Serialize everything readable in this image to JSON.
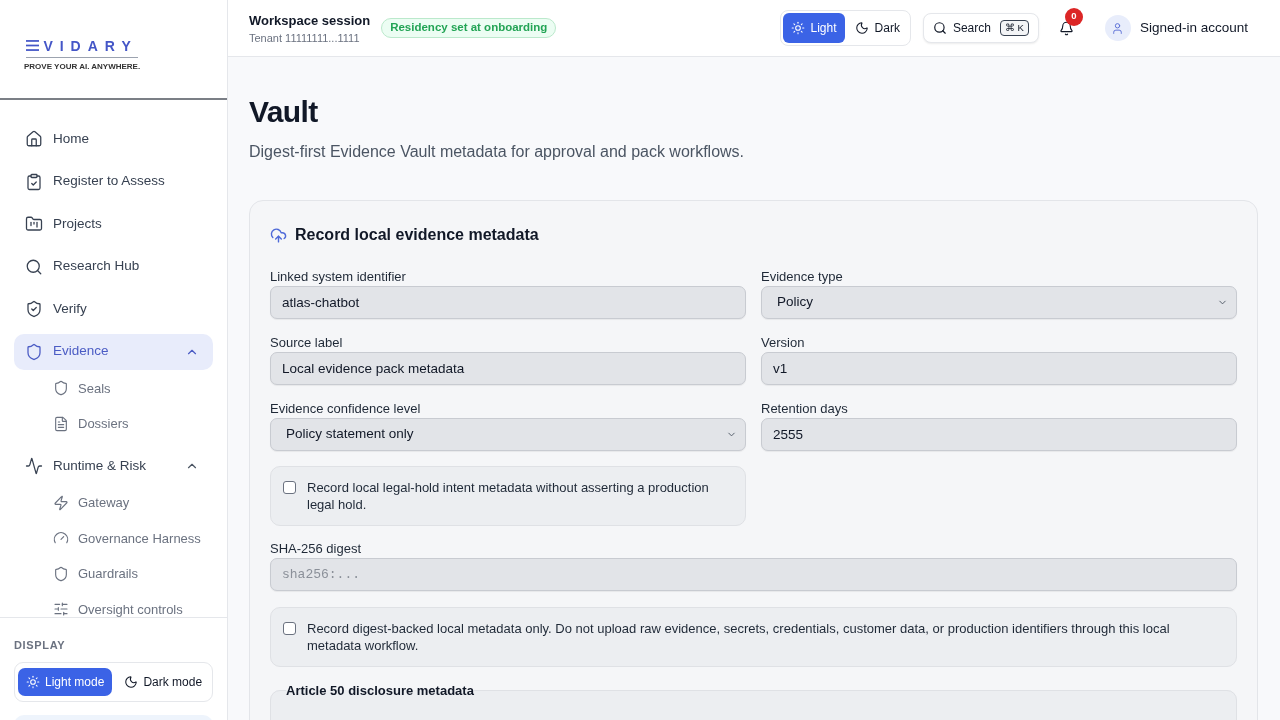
{
  "brand": {
    "wordmark": "VIDARY",
    "tagline": "PROVE YOUR AI. ANYWHERE."
  },
  "sidebar": {
    "items": [
      {
        "label": "Home",
        "selected": false
      },
      {
        "label": "Register to Assess",
        "selected": false
      },
      {
        "label": "Projects",
        "selected": false
      },
      {
        "label": "Research Hub",
        "selected": false
      },
      {
        "label": "Verify",
        "selected": false
      },
      {
        "label": "Evidence",
        "selected": true,
        "expanded": true,
        "children": [
          {
            "label": "Seals",
            "selected": false
          },
          {
            "label": "Dossiers",
            "selected": false
          }
        ]
      },
      {
        "label": "Runtime & Risk",
        "selected": false,
        "expanded": true,
        "children": [
          {
            "label": "Gateway",
            "selected": false
          },
          {
            "label": "Governance Harness",
            "selected": false
          },
          {
            "label": "Guardrails",
            "selected": false
          },
          {
            "label": "Oversight controls",
            "selected": false
          }
        ]
      }
    ]
  },
  "display": {
    "label": "DISPLAY",
    "options": [
      {
        "label": "Light mode",
        "selected": true
      },
      {
        "label": "Dark mode",
        "selected": false
      }
    ]
  },
  "header": {
    "title": "Workspace session",
    "subtitle": "Tenant 11111111...1111",
    "badge": "Residency set at onboarding",
    "theme_toggle": [
      {
        "label": "Light",
        "selected": true
      },
      {
        "label": "Dark",
        "selected": false
      }
    ],
    "search": {
      "label": "Search",
      "shortcut": "⌘ K"
    },
    "notifications": {
      "count": "0"
    },
    "account": {
      "label": "Signed-in account"
    }
  },
  "page": {
    "title": "Vault",
    "subtitle": "Digest-first Evidence Vault metadata for approval and pack workflows."
  },
  "form": {
    "title": "Record local evidence metadata",
    "fields": [
      {
        "label": "Linked system identifier",
        "kind": "text",
        "value": "atlas-chatbot"
      },
      {
        "label": "Evidence type",
        "kind": "select",
        "value": "Policy"
      },
      {
        "label": "Source label",
        "kind": "text",
        "value": "Local evidence pack metadata"
      },
      {
        "label": "Version",
        "kind": "text",
        "value": "v1"
      },
      {
        "label": "Evidence confidence level",
        "kind": "select",
        "value": "Policy statement only"
      },
      {
        "label": "Retention days",
        "kind": "text",
        "value": "2555"
      }
    ],
    "legal_hold": {
      "label": "Record local legal-hold intent metadata without asserting a production legal hold.",
      "checked": false
    },
    "digest": {
      "label": "SHA-256 digest",
      "placeholder": "sha256:..."
    },
    "attestation": {
      "label": "Record digest-backed local metadata only. Do not upload raw evidence, secrets, credentials, customer data, or production identifiers through this local metadata workflow.",
      "checked": false
    },
    "disclosure": {
      "legend": "Article 50 disclosure metadata"
    }
  }
}
